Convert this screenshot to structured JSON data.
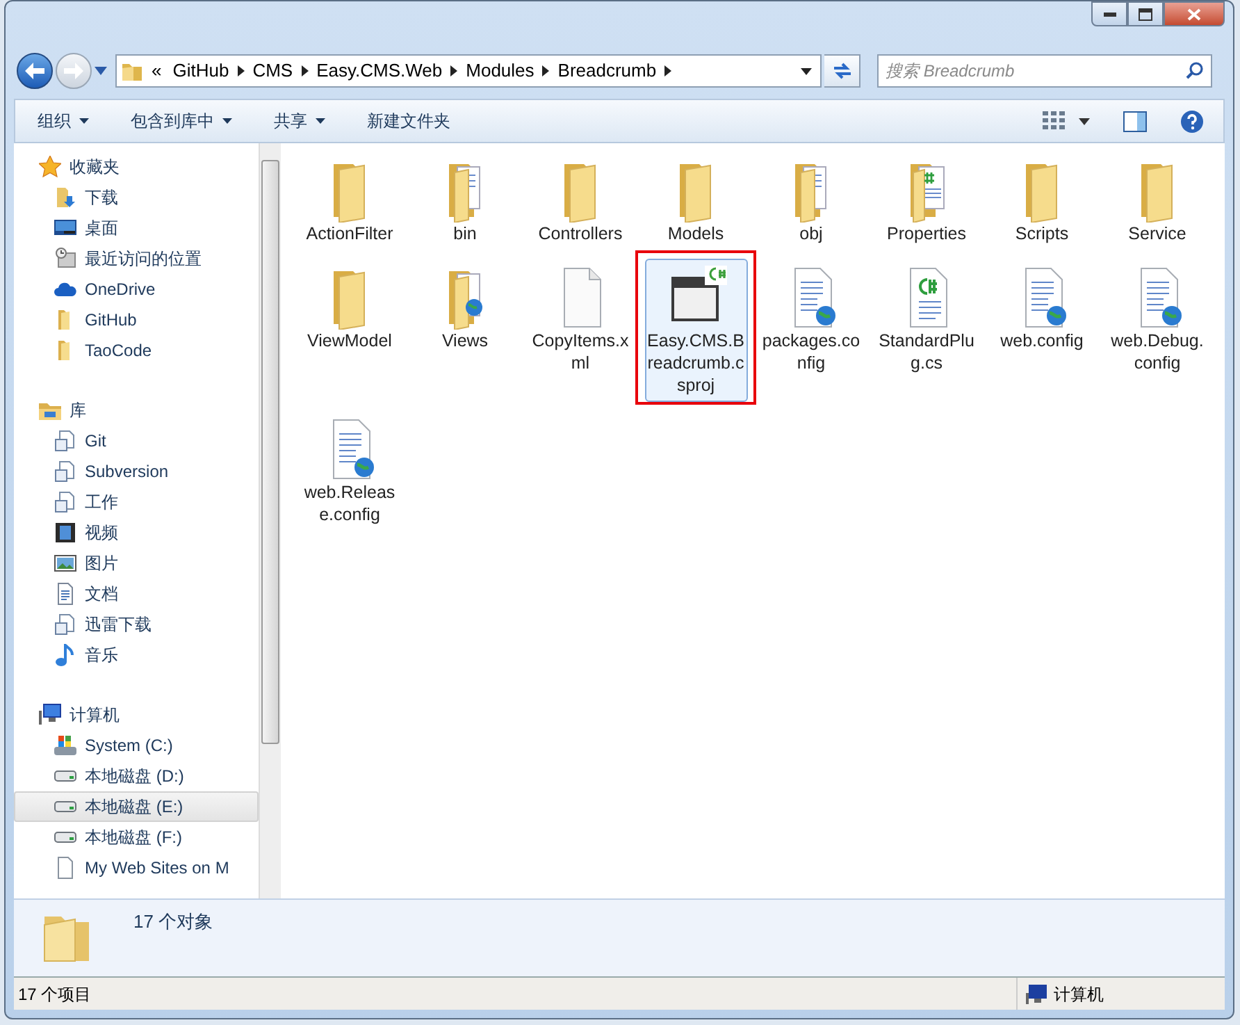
{
  "address_bar": {
    "overflow": "«",
    "segments": [
      "GitHub",
      "CMS",
      "Easy.CMS.Web",
      "Modules",
      "Breadcrumb"
    ]
  },
  "search": {
    "placeholder": "搜索 Breadcrumb"
  },
  "toolbar": {
    "menus": [
      {
        "label": "组织",
        "dropdown": true
      },
      {
        "label": "包含到库中",
        "dropdown": true
      },
      {
        "label": "共享",
        "dropdown": true
      },
      {
        "label": "新建文件夹",
        "dropdown": false
      }
    ]
  },
  "sidebar": {
    "groups": [
      {
        "label": "收藏夹",
        "children": [
          {
            "label": "下载",
            "selected": false
          },
          {
            "label": "桌面",
            "selected": false
          },
          {
            "label": "最近访问的位置",
            "selected": false
          },
          {
            "label": "OneDrive",
            "selected": false
          },
          {
            "label": "GitHub",
            "selected": false
          },
          {
            "label": "TaoCode",
            "selected": false
          }
        ]
      },
      {
        "label": "库",
        "children": [
          {
            "label": "Git",
            "selected": false
          },
          {
            "label": "Subversion",
            "selected": false
          },
          {
            "label": "工作",
            "selected": false
          },
          {
            "label": "视频",
            "selected": false
          },
          {
            "label": "图片",
            "selected": false
          },
          {
            "label": "文档",
            "selected": false
          },
          {
            "label": "迅雷下载",
            "selected": false
          },
          {
            "label": "音乐",
            "selected": false
          }
        ]
      },
      {
        "label": "计算机",
        "children": [
          {
            "label": "System (C:)",
            "selected": false
          },
          {
            "label": "本地磁盘 (D:)",
            "selected": false
          },
          {
            "label": "本地磁盘 (E:)",
            "selected": true
          },
          {
            "label": "本地磁盘 (F:)",
            "selected": false
          },
          {
            "label": "My Web Sites on M",
            "selected": false
          }
        ]
      }
    ]
  },
  "files": [
    {
      "label": "ActionFilter",
      "kind": "folder",
      "selected": false,
      "highlighted": false
    },
    {
      "label": "bin",
      "kind": "folder_files",
      "selected": false,
      "highlighted": false
    },
    {
      "label": "Controllers",
      "kind": "folder",
      "selected": false,
      "highlighted": false
    },
    {
      "label": "Models",
      "kind": "folder",
      "selected": false,
      "highlighted": false
    },
    {
      "label": "obj",
      "kind": "folder_files",
      "selected": false,
      "highlighted": false
    },
    {
      "label": "Properties",
      "kind": "folder_code",
      "selected": false,
      "highlighted": false
    },
    {
      "label": "Scripts",
      "kind": "folder",
      "selected": false,
      "highlighted": false
    },
    {
      "label": "Service",
      "kind": "folder",
      "selected": false,
      "highlighted": false
    },
    {
      "label": "ViewModel",
      "kind": "folder",
      "selected": false,
      "highlighted": false
    },
    {
      "label": "Views",
      "kind": "folder_web",
      "selected": false,
      "highlighted": false
    },
    {
      "label": "CopyItems.xml",
      "kind": "file",
      "selected": false,
      "highlighted": false
    },
    {
      "label": "Easy.CMS.Breadcrumb.csproj",
      "kind": "project",
      "selected": true,
      "highlighted": true
    },
    {
      "label": "packages.config",
      "kind": "config",
      "selected": false,
      "highlighted": false
    },
    {
      "label": "StandardPlug.cs",
      "kind": "code",
      "selected": false,
      "highlighted": false
    },
    {
      "label": "web.config",
      "kind": "config",
      "selected": false,
      "highlighted": false
    },
    {
      "label": "web.Debug.config",
      "kind": "config",
      "selected": false,
      "highlighted": false
    },
    {
      "label": "web.Release.config",
      "kind": "config",
      "selected": false,
      "highlighted": false
    }
  ],
  "details_pane": {
    "text": "17 个对象"
  },
  "status_bar": {
    "count": "17 个项目",
    "location": "计算机"
  }
}
